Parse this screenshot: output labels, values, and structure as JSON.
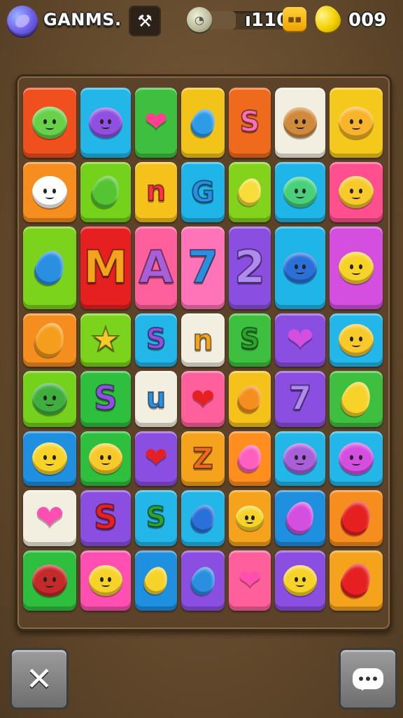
{
  "header": {
    "title": "GANMS.",
    "tool_icon": "pickaxe-icon",
    "progress_value": "110",
    "progress_prefix": "ı",
    "score": "009"
  },
  "board": {
    "rows": [
      [
        {
          "kind": "blob",
          "bg": "#f0501e",
          "fg": "#67d14a"
        },
        {
          "kind": "blob",
          "bg": "#23b6e8",
          "fg": "#8f4fe0"
        },
        {
          "kind": "heart",
          "bg": "#3fbf3f",
          "fg": "#ff3f8f"
        },
        {
          "kind": "drop",
          "bg": "#f2c41a",
          "fg": "#2e9be8"
        },
        {
          "kind": "glyph",
          "bg": "#f06a1e",
          "fg": "#ff6fb5",
          "text": "S"
        },
        {
          "kind": "blob",
          "bg": "#f3efe0",
          "fg": "#d08a3c"
        },
        {
          "kind": "blob",
          "bg": "#f5c81c",
          "fg": "#f8b52a"
        }
      ],
      [
        {
          "kind": "blob",
          "bg": "#f58e1e",
          "fg": "#ffffff"
        },
        {
          "kind": "drop",
          "bg": "#74d11c",
          "fg": "#54c432"
        },
        {
          "kind": "glyph",
          "bg": "#f5c21c",
          "fg": "#ff3040",
          "text": "n"
        },
        {
          "kind": "glyph",
          "bg": "#1fb5e8",
          "fg": "#2a8fe0",
          "text": "G"
        },
        {
          "kind": "drop",
          "bg": "#83d31c",
          "fg": "#f7dc3a"
        },
        {
          "kind": "blob",
          "bg": "#1fb5e8",
          "fg": "#48d17a"
        },
        {
          "kind": "blob",
          "bg": "#ff4f8f",
          "fg": "#f7c92a"
        }
      ],
      [
        {
          "kind": "drop",
          "bg": "#7cd31c",
          "fg": "#2a8fe0"
        },
        {
          "kind": "glyph",
          "bg": "#e62020",
          "fg": "#f5a21c",
          "text": "M"
        },
        {
          "kind": "glyph",
          "bg": "#ff5f9a",
          "fg": "#a85fd8",
          "text": "A"
        },
        {
          "kind": "glyph",
          "bg": "#ff74b8",
          "fg": "#2a8fe0",
          "text": "7"
        },
        {
          "kind": "glyph",
          "bg": "#8a4fe0",
          "fg": "#b08af0",
          "text": "2"
        },
        {
          "kind": "blob",
          "bg": "#1fb5e8",
          "fg": "#2a70d8"
        },
        {
          "kind": "blob",
          "bg": "#d44fe0",
          "fg": "#f7d32a"
        }
      ],
      [
        {
          "kind": "drop",
          "bg": "#f58e1e",
          "fg": "#f59e1e"
        },
        {
          "kind": "glyph",
          "bg": "#7cd31c",
          "fg": "#f7c92a",
          "text": "★"
        },
        {
          "kind": "glyph",
          "bg": "#23b6e8",
          "fg": "#8f4fe0",
          "text": "S"
        },
        {
          "kind": "glyph",
          "bg": "#f3efe0",
          "fg": "#f5a21c",
          "text": "n"
        },
        {
          "kind": "glyph",
          "bg": "#3fbf3f",
          "fg": "#2aa32a",
          "text": "S"
        },
        {
          "kind": "heart",
          "bg": "#8a4fe0",
          "fg": "#d44fe0"
        },
        {
          "kind": "blob",
          "bg": "#23b6e8",
          "fg": "#f7c92a"
        }
      ],
      [
        {
          "kind": "blob",
          "bg": "#74d11c",
          "fg": "#3fae3f"
        },
        {
          "kind": "glyph",
          "bg": "#2fbf3f",
          "fg": "#8f4fe0",
          "text": "S"
        },
        {
          "kind": "glyph",
          "bg": "#f3efe0",
          "fg": "#2a8fe0",
          "text": "u"
        },
        {
          "kind": "heart",
          "bg": "#ff5f9a",
          "fg": "#e62020"
        },
        {
          "kind": "drop",
          "bg": "#f5c21c",
          "fg": "#f58e1e"
        },
        {
          "kind": "glyph",
          "bg": "#8a4fe0",
          "fg": "#b08af0",
          "text": "7"
        },
        {
          "kind": "drop",
          "bg": "#3fbf3f",
          "fg": "#f7d32a"
        }
      ],
      [
        {
          "kind": "blob",
          "bg": "#1f8fe0",
          "fg": "#f7d32a"
        },
        {
          "kind": "blob",
          "bg": "#2fbf3f",
          "fg": "#f7c92a"
        },
        {
          "kind": "heart",
          "bg": "#8a4fe0",
          "fg": "#e62020"
        },
        {
          "kind": "glyph",
          "bg": "#f5a21c",
          "fg": "#f06a1e",
          "text": "Z"
        },
        {
          "kind": "drop",
          "bg": "#ff8e1e",
          "fg": "#ff5fc0"
        },
        {
          "kind": "blob",
          "bg": "#23b6e8",
          "fg": "#a85fd8"
        },
        {
          "kind": "blob",
          "bg": "#23b6e8",
          "fg": "#d44fe0"
        }
      ],
      [
        {
          "kind": "heart",
          "bg": "#f3efe0",
          "fg": "#ff4fb0"
        },
        {
          "kind": "glyph",
          "bg": "#8a4fe0",
          "fg": "#e62020",
          "text": "S"
        },
        {
          "kind": "glyph",
          "bg": "#23b6e8",
          "fg": "#2aa32a",
          "text": "S"
        },
        {
          "kind": "drop",
          "bg": "#23b6e8",
          "fg": "#2a70d8"
        },
        {
          "kind": "blob",
          "bg": "#f5a21c",
          "fg": "#f7d32a"
        },
        {
          "kind": "drop",
          "bg": "#1f8fe0",
          "fg": "#d44fe0"
        },
        {
          "kind": "drop",
          "bg": "#f58e1e",
          "fg": "#e62020"
        }
      ],
      [
        {
          "kind": "blob",
          "bg": "#2fbf3f",
          "fg": "#c42a2a"
        },
        {
          "kind": "blob",
          "bg": "#ff4fb0",
          "fg": "#f7d32a"
        },
        {
          "kind": "drop",
          "bg": "#1f8fe0",
          "fg": "#f7d32a"
        },
        {
          "kind": "drop",
          "bg": "#8a4fe0",
          "fg": "#2a8fe0"
        },
        {
          "kind": "heart",
          "bg": "#ff5f9a",
          "fg": "#ff4fb0"
        },
        {
          "kind": "blob",
          "bg": "#8a4fe0",
          "fg": "#f7d32a"
        },
        {
          "kind": "drop",
          "bg": "#f5a21c",
          "fg": "#e62020"
        }
      ]
    ]
  },
  "controls": {
    "back_icon": "close-x-icon",
    "chat_icon": "chat-bubble-icon"
  }
}
